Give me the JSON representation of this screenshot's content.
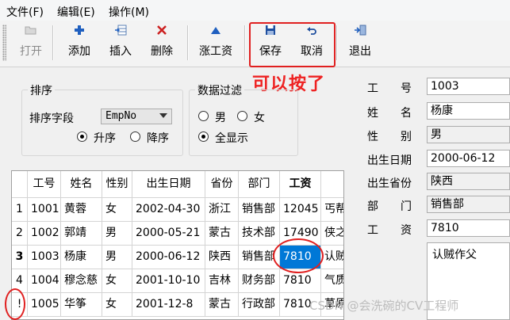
{
  "menu": [
    "文件(F)",
    "编辑(E)",
    "操作(M)"
  ],
  "toolbar": {
    "open": "打开",
    "add": "添加",
    "insert": "插入",
    "delete": "删除",
    "raise_salary": "涨工资",
    "save": "保存",
    "cancel": "取消",
    "exit": "退出"
  },
  "annotation": "可以按了",
  "sort": {
    "title": "排序",
    "field_label": "排序字段",
    "field_value": "EmpNo",
    "asc": "升序",
    "desc": "降序",
    "selected": "asc"
  },
  "filter": {
    "title": "数据过滤",
    "male": "男",
    "female": "女",
    "all": "全显示",
    "selected": "all"
  },
  "grid": {
    "headers": [
      "工号",
      "姓名",
      "性别",
      "出生日期",
      "省份",
      "部门",
      "工资",
      ""
    ],
    "rows": [
      {
        "indicator": "1",
        "cells": [
          "1001",
          "黄蓉",
          "女",
          "2002-04-30",
          "浙江",
          "销售部",
          "12045",
          "丐帮"
        ]
      },
      {
        "indicator": "2",
        "cells": [
          "1002",
          "郭靖",
          "男",
          "2000-05-21",
          "蒙古",
          "技术部",
          "17490",
          "侠之"
        ]
      },
      {
        "indicator": "3",
        "cells": [
          "1003",
          "杨康",
          "男",
          "2000-06-12",
          "陕西",
          "销售部",
          "7810",
          "认贼"
        ]
      },
      {
        "indicator": "4",
        "cells": [
          "1004",
          "穆念慈",
          "女",
          "2001-10-10",
          "吉林",
          "财务部",
          "7810",
          "气质"
        ]
      },
      {
        "indicator": "!",
        "cells": [
          "1005",
          "华筝",
          "女",
          "2001-12-8",
          "蒙古",
          "行政部",
          "7810",
          "草原"
        ]
      }
    ]
  },
  "detail": {
    "labels": [
      "工　　号",
      "姓　　名",
      "性　　别",
      "出生日期",
      "出生省份",
      "部　　门",
      "工　　资"
    ],
    "values": [
      "1003",
      "杨康",
      "男",
      "2000-06-12",
      "陕西",
      "销售部",
      "7810"
    ],
    "memo": "认贼作父"
  },
  "watermark": "CSDN @会洗碗的CV工程师",
  "colors": {
    "annotation_red": "#ee2222",
    "selection_blue": "#0078d7"
  }
}
